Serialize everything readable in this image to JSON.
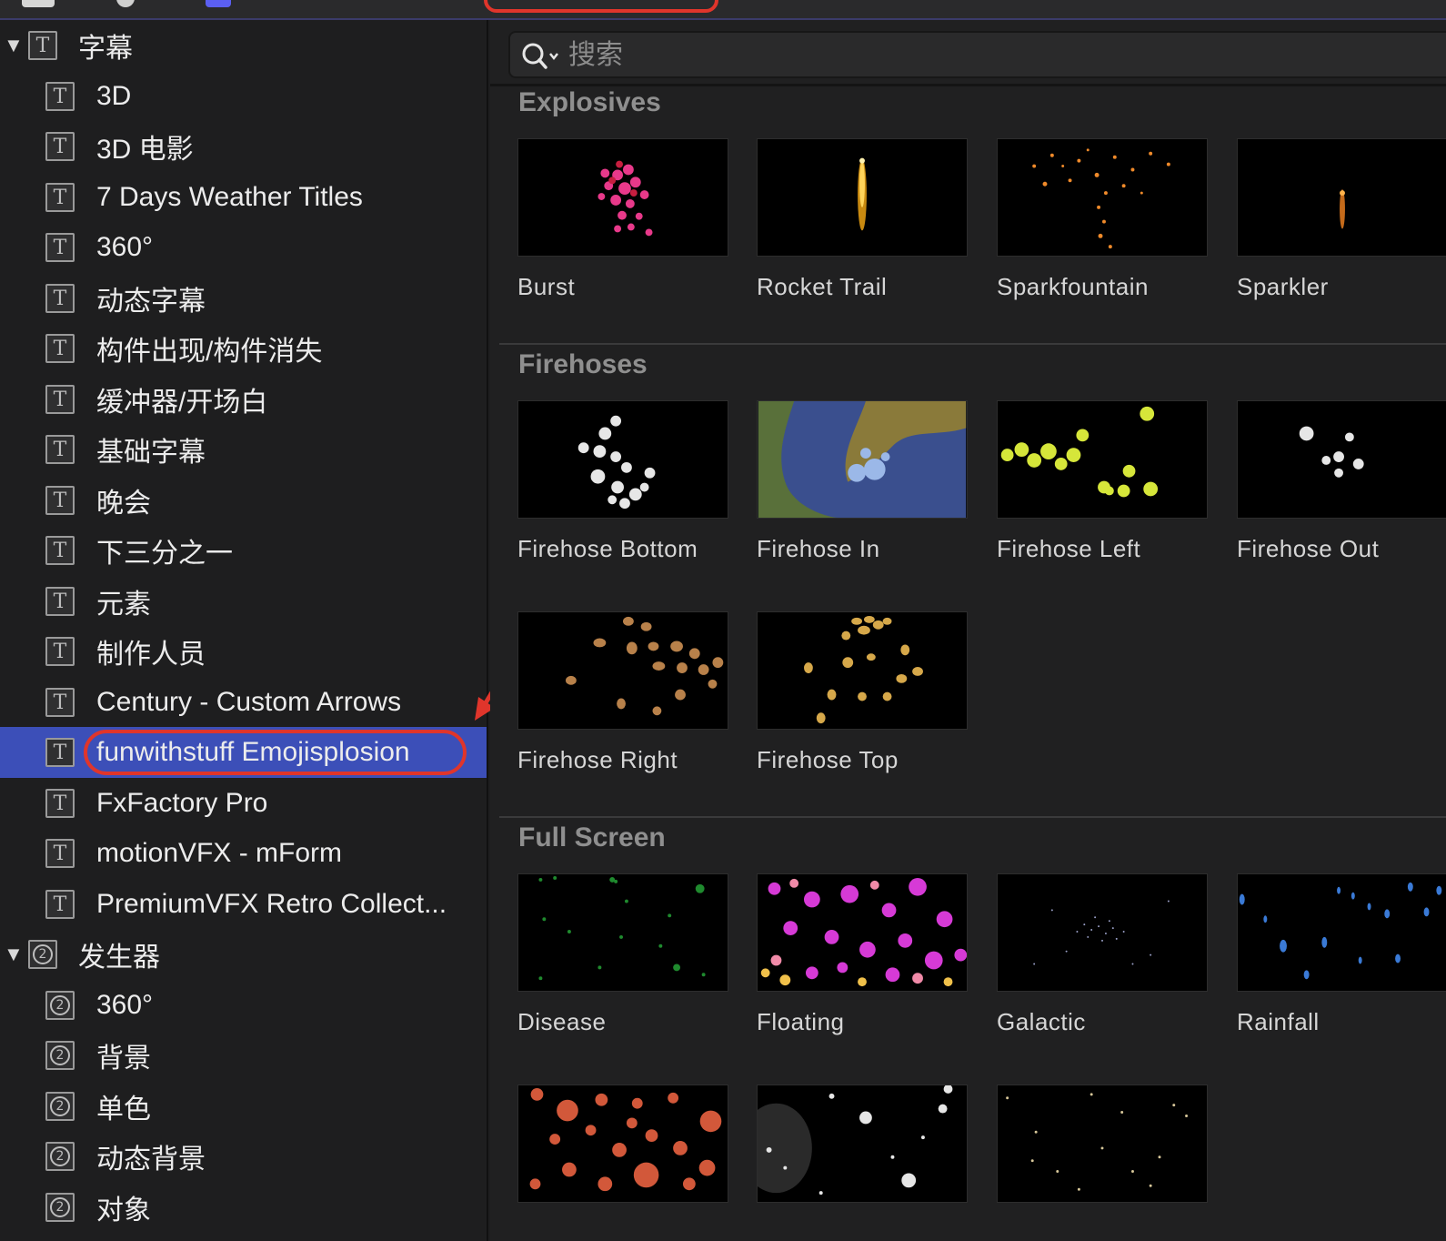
{
  "colors": {
    "accent": "#3c4fb8",
    "highlight": "#e0352b",
    "background": "#1e1e1f"
  },
  "sidebar": {
    "groups": [
      {
        "label": "字幕",
        "icon": "titles-icon",
        "items": [
          "3D",
          "3D 电影",
          "7 Days Weather Titles",
          "360°",
          "动态字幕",
          "构件出现/构件消失",
          "缓冲器/开场白",
          "基础字幕",
          "晚会",
          "下三分之一",
          "元素",
          "制作人员",
          "Century - Custom Arrows",
          "funwithstuff Emojisplosion",
          "FxFactory Pro",
          "motionVFX - mForm",
          "PremiumVFX Retro Collect..."
        ],
        "selected_index": 13
      },
      {
        "label": "发生器",
        "icon": "generators-icon",
        "items": [
          "360°",
          "背景",
          "单色",
          "动态背景",
          "对象"
        ]
      }
    ]
  },
  "search": {
    "placeholder": "搜索"
  },
  "sections": [
    {
      "title": "Explosives",
      "tiles": [
        "Burst",
        "Rocket Trail",
        "Sparkfountain",
        "Sparkler"
      ]
    },
    {
      "title": "Firehoses",
      "tiles": [
        "Firehose Bottom",
        "Firehose In",
        "Firehose Left",
        "Firehose Out",
        "Firehose Right",
        "Firehose Top"
      ]
    },
    {
      "title": "Full Screen",
      "tiles": [
        "Disease",
        "Floating",
        "Galactic",
        "Rainfall",
        "",
        "",
        ""
      ]
    }
  ]
}
